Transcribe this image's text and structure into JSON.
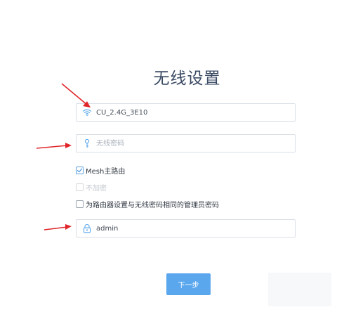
{
  "page": {
    "title": "无线设置"
  },
  "form": {
    "ssid": {
      "value": "CU_2.4G_3E10",
      "icon": "wifi-icon"
    },
    "wifi_password": {
      "value": "",
      "placeholder": "无线密码",
      "icon": "key-icon"
    },
    "mesh_checkbox": {
      "label": "Mesh主路由",
      "checked": true
    },
    "no_encryption_checkbox": {
      "label": "不加密",
      "checked": false,
      "disabled": true
    },
    "same_admin_password_checkbox": {
      "label": "为路由器设置与无线密码相同的管理员密码",
      "checked": false
    },
    "admin_password": {
      "value": "admin",
      "icon": "lock-icon"
    }
  },
  "actions": {
    "next_label": "下一步"
  },
  "colors": {
    "accent": "#5aa7ee",
    "annotation": "#e0262a",
    "title": "#3a4a63",
    "border": "#d8dee6"
  }
}
